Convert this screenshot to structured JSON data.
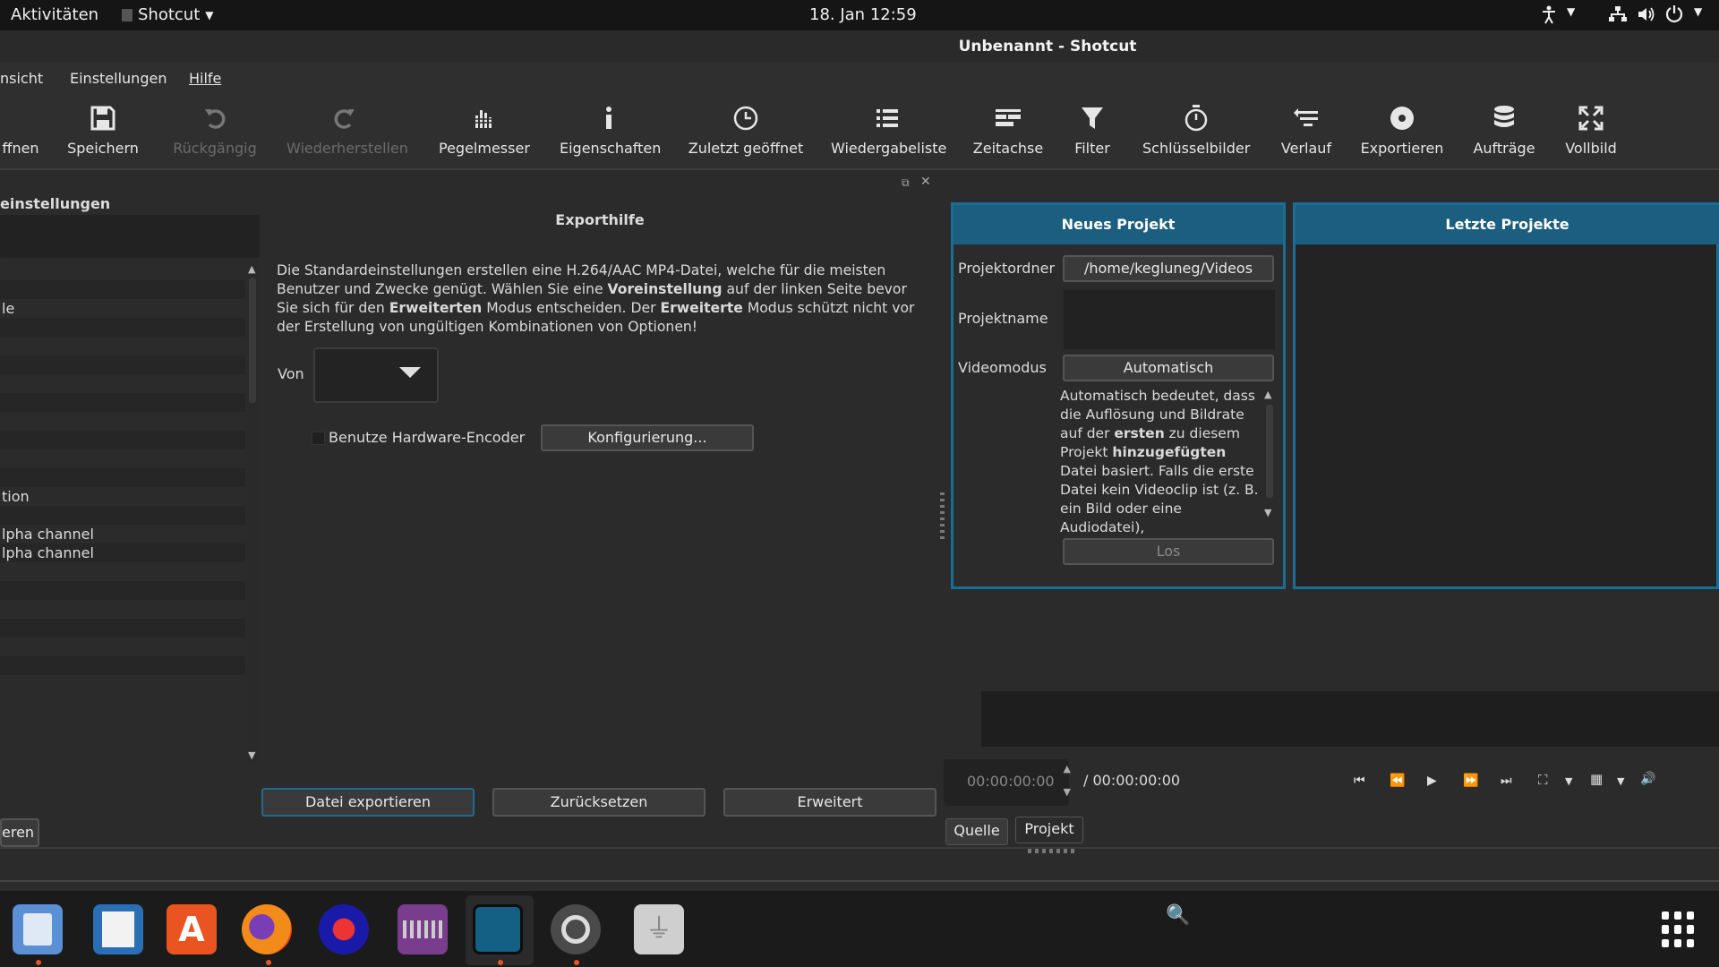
{
  "topbar": {
    "activities": "Aktivitäten",
    "app_menu": "Shotcut",
    "clock": "18. Jan  12:59"
  },
  "window": {
    "title": "Unbenannt - Shotcut"
  },
  "menu": {
    "items": [
      "nsicht",
      "Einstellungen",
      "Hilfe"
    ]
  },
  "toolbar": {
    "items": [
      {
        "label": "ffnen",
        "icon": "open-icon"
      },
      {
        "label": "Speichern",
        "icon": "save-icon"
      },
      {
        "label": "Rückgängig",
        "icon": "undo-icon"
      },
      {
        "label": "Wiederherstellen",
        "icon": "redo-icon"
      },
      {
        "label": "Pegelmesser",
        "icon": "meter-icon"
      },
      {
        "label": "Eigenschaften",
        "icon": "info-icon"
      },
      {
        "label": "Zuletzt geöffnet",
        "icon": "clock-icon"
      },
      {
        "label": "Wiedergabeliste",
        "icon": "list-icon"
      },
      {
        "label": "Zeitachse",
        "icon": "timeline-icon"
      },
      {
        "label": "Filter",
        "icon": "filter-icon"
      },
      {
        "label": "Schlüsselbilder",
        "icon": "stopwatch-icon"
      },
      {
        "label": "Verlauf",
        "icon": "history-icon"
      },
      {
        "label": "Exportieren",
        "icon": "export-icon"
      },
      {
        "label": "Aufträge",
        "icon": "jobs-icon"
      },
      {
        "label": "Vollbild",
        "icon": "fullscreen-icon"
      }
    ]
  },
  "left_panel": {
    "title": "einstellungen",
    "rows": [
      "",
      "",
      "le",
      "",
      "",
      "",
      "",
      "",
      "",
      "",
      "",
      "",
      "tion",
      "",
      "lpha channel",
      "lpha channel",
      "",
      "",
      "",
      "",
      "",
      "",
      ""
    ],
    "bottom_button": "eren"
  },
  "export": {
    "title": "Exporthilfe",
    "text_parts": [
      {
        "t": "Die Standardeinstellungen erstellen eine H.264/AAC MP4-Datei, welche für die meisten Benutzer und Zwecke genügt. Wählen Sie eine ",
        "b": false
      },
      {
        "t": "Voreinstellung",
        "b": true
      },
      {
        "t": " auf der linken Seite bevor Sie sich für den ",
        "b": false
      },
      {
        "t": "Erweiterten",
        "b": true
      },
      {
        "t": " Modus entscheiden. Der ",
        "b": false
      },
      {
        "t": "Erweiterte",
        "b": true
      },
      {
        "t": " Modus schützt nicht vor der Erstellung von ungültigen Kombinationen von Optionen!",
        "b": false
      }
    ],
    "von_label": "Von",
    "hw_encoder_label": "Benutze Hardware-Encoder",
    "configure_button": "Konfigurierung...",
    "export_button": "Datei exportieren",
    "reset_button": "Zurücksetzen",
    "advanced_button": "Erweitert"
  },
  "new_project": {
    "header": "Neues Projekt",
    "folder_label": "Projektordner",
    "folder_value": "/home/kegluneg/Videos",
    "name_label": "Projektname",
    "name_value": "",
    "videomode_label": "Videomodus",
    "videomode_value": "Automatisch",
    "desc_parts": [
      {
        "t": "Automatisch bedeutet, dass die Auflösung und Bildrate auf der ",
        "b": false
      },
      {
        "t": "ersten",
        "b": true
      },
      {
        "t": " zu diesem Projekt ",
        "b": false
      },
      {
        "t": "hinzugefügten",
        "b": true
      },
      {
        "t": " Datei basiert. Falls die erste Datei kein Videoclip ist (z. B. ein Bild oder eine Audiodatei),",
        "b": false
      }
    ],
    "go_button": "Los"
  },
  "recent_projects": {
    "header": "Letzte Projekte"
  },
  "player": {
    "timecode": "00:00:00:00",
    "duration": "/ 00:00:00:00",
    "tabs": [
      "Quelle",
      "Projekt"
    ]
  },
  "colors": {
    "accent": "#1b5e80",
    "ubuntu_orange": "#e95420"
  }
}
